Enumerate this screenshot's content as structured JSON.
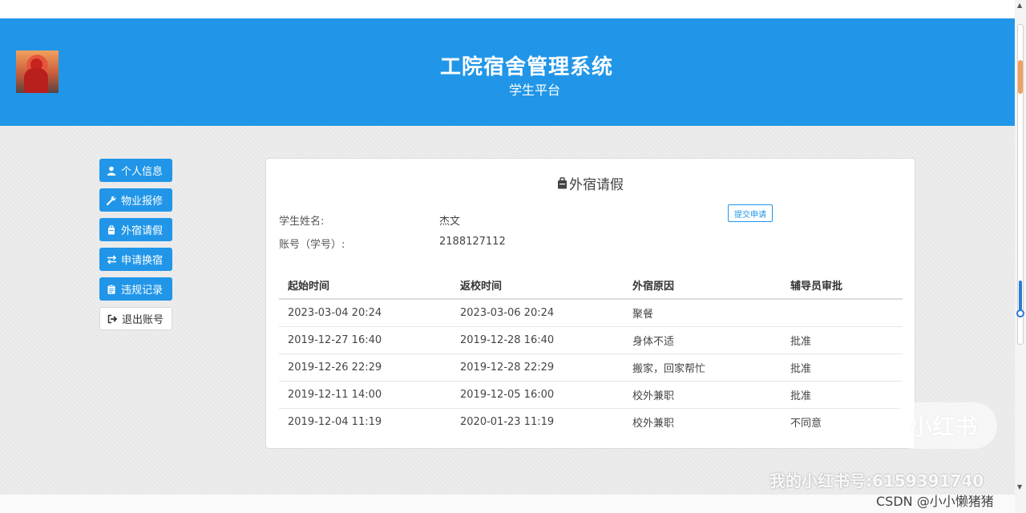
{
  "header": {
    "title": "工院宿舍管理系统",
    "subtitle": "学生平台"
  },
  "nav": [
    {
      "label": "个人信息",
      "icon": "user-icon"
    },
    {
      "label": "物业报修",
      "icon": "wrench-icon"
    },
    {
      "label": "外宿请假",
      "icon": "suitcase-icon"
    },
    {
      "label": "申请换宿",
      "icon": "swap-icon"
    },
    {
      "label": "违规记录",
      "icon": "clipboard-icon"
    },
    {
      "label": "退出账号",
      "icon": "sign-out-icon"
    }
  ],
  "panel": {
    "title": "外宿请假",
    "name_label": "学生姓名:",
    "name_value": "杰文",
    "account_label": "账号（学号）:",
    "account_value": "2188127112",
    "submit_label": "提交申请"
  },
  "table": {
    "headers": [
      "起始时间",
      "返校时间",
      "外宿原因",
      "辅导员审批"
    ],
    "rows": [
      [
        "2023-03-04 20:24",
        "2023-03-06 20:24",
        "聚餐",
        ""
      ],
      [
        "2019-12-27 16:40",
        "2019-12-28 16:40",
        "身体不适",
        "批准"
      ],
      [
        "2019-12-26 22:29",
        "2019-12-28 22:29",
        "搬家，回家帮忙",
        "批准"
      ],
      [
        "2019-12-11 14:00",
        "2019-12-05 16:00",
        "校外兼职",
        "批准"
      ],
      [
        "2019-12-04 11:19",
        "2020-01-23 11:19",
        "校外兼职",
        "不同意"
      ]
    ]
  },
  "watermark": {
    "logo": "小红书",
    "line": "我的小红书号:6159391740",
    "csdn": "CSDN @小小懒猪猪"
  },
  "colors": {
    "primary": "#2196e8"
  }
}
